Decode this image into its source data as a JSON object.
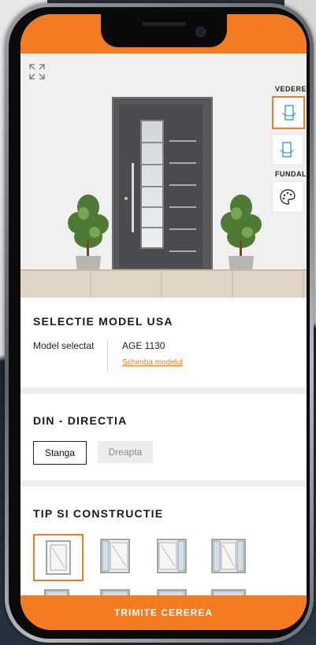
{
  "colors": {
    "accent": "#f47b20",
    "door": "#4a4b4e"
  },
  "preview": {
    "expand_icon": "expand-icon",
    "side_title_view": "VEDERE",
    "side_title_background": "FUNDAL",
    "view_icons": [
      "door-outside-view-icon",
      "door-inside-view-icon",
      "palette-icon"
    ]
  },
  "model_section": {
    "title": "SELECTIE MODEL USA",
    "label": "Model selectat",
    "model_name": "AGE 1130",
    "change_link": "Schimba modelul"
  },
  "direction_section": {
    "title": "DIN - DIRECTIA",
    "options": [
      "Stanga",
      "Dreapta"
    ],
    "selected": "Stanga"
  },
  "construction_section": {
    "title": "TIP SI CONSTRUCTIE",
    "selected_index": 0
  },
  "footer": {
    "submit_label": "TRIMITE CEREREA"
  }
}
